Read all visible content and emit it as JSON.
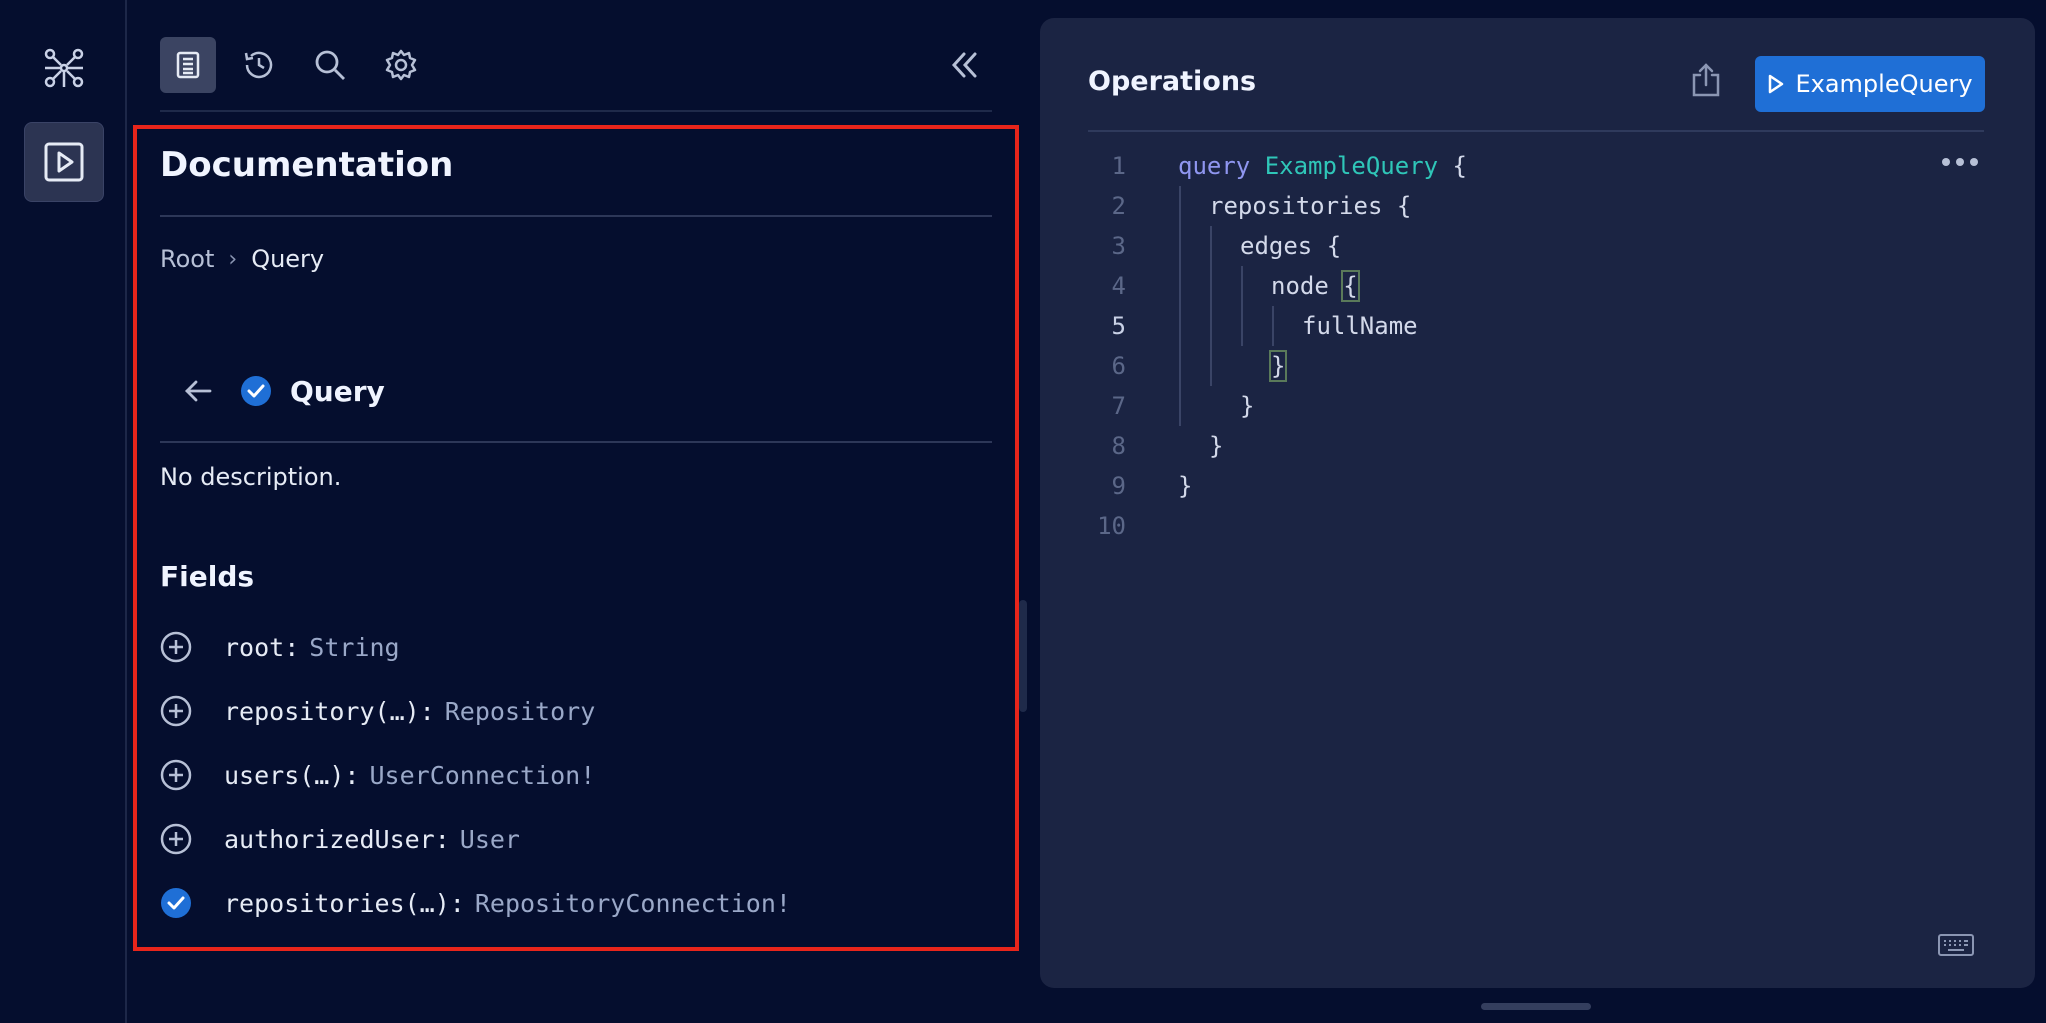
{
  "rail": {
    "logo_icon": "graphql-logo-icon",
    "plugin_icon": "play-square-icon"
  },
  "toolbar": {
    "icons": [
      "documentation-icon",
      "history-icon",
      "search-icon",
      "settings-icon"
    ],
    "collapse_icon": "double-chevron-left-icon"
  },
  "docs": {
    "title": "Documentation",
    "breadcrumb": [
      "Root",
      "Query"
    ],
    "breadcrumb_sep": "›",
    "type_title": "Query",
    "description": "No description.",
    "fields_title": "Fields",
    "fields": [
      {
        "name": "root",
        "colon": ":",
        "type": "String",
        "icon": "plus-circle-icon"
      },
      {
        "name": "repository(…)",
        "colon": ":",
        "type": "Repository",
        "icon": "plus-circle-icon"
      },
      {
        "name": "users(…)",
        "colon": ":",
        "type": "UserConnection!",
        "icon": "plus-circle-icon"
      },
      {
        "name": "authorizedUser",
        "colon": ":",
        "type": "User",
        "icon": "plus-circle-icon"
      },
      {
        "name": "repositories(…)",
        "colon": ":",
        "type": "RepositoryConnection!",
        "icon": "check-circle-icon"
      }
    ]
  },
  "editor": {
    "title": "Operations",
    "run_label": "ExampleQuery",
    "share_icon": "share-icon",
    "more_icon": "more-horizontal-icon",
    "keyboard_icon": "keyboard-icon",
    "line_numbers": [
      "1",
      "2",
      "3",
      "4",
      "5",
      "6",
      "7",
      "8",
      "9",
      "10"
    ],
    "current_line": "5",
    "code": {
      "l1_kw": "query",
      "l1_name": "ExampleQuery",
      "l1_brace": " {",
      "l2": "repositories {",
      "l3": "edges {",
      "l4_field": "node ",
      "l4_brace": "{",
      "l5": "fullName",
      "l6": "}",
      "l7": "}",
      "l8": "}",
      "l9": "}"
    }
  },
  "colors": {
    "background": "#050e2e",
    "editor_bg": "#1b2443",
    "accent": "#1f6fd6",
    "highlight_border": "#e8251b",
    "keyword": "#8f96f0",
    "operation_name": "#2fc6b8"
  }
}
